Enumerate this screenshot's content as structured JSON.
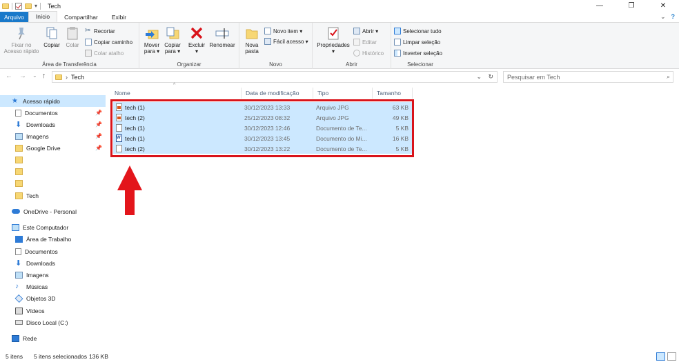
{
  "window": {
    "title": "Tech",
    "minimize": "—",
    "restore": "❐",
    "close": "✕"
  },
  "tabs": {
    "file": "Arquivo",
    "home": "Início",
    "share": "Compartilhar",
    "view": "Exibir"
  },
  "ribbon": {
    "clipboard": {
      "label": "Área de Transferência",
      "pin_quick": "Fixar no\nAcesso rápido",
      "copy": "Copiar",
      "paste": "Colar",
      "cut": "Recortar",
      "copy_path": "Copiar caminho",
      "paste_shortcut": "Colar atalho"
    },
    "organize": {
      "label": "Organizar",
      "move_to": "Mover\npara ▾",
      "copy_to": "Copiar\npara ▾",
      "delete": "Excluir\n▾",
      "rename": "Renomear"
    },
    "new": {
      "label": "Novo",
      "new_folder": "Nova\npasta",
      "new_item": "Novo item ▾",
      "easy_access": "Fácil acesso ▾"
    },
    "open": {
      "label": "Abrir",
      "properties": "Propriedades\n▾",
      "open": "Abrir ▾",
      "edit": "Editar",
      "history": "Histórico"
    },
    "select": {
      "label": "Selecionar",
      "select_all": "Selecionar tudo",
      "select_none": "Limpar seleção",
      "invert": "Inverter seleção"
    }
  },
  "address": {
    "path": "Tech",
    "search_placeholder": "Pesquisar em Tech"
  },
  "nav": {
    "quick_access": "Acesso rápido",
    "quick_items": [
      "Documentos",
      "Downloads",
      "Imagens",
      "Google Drive",
      "",
      "",
      "",
      "Tech"
    ],
    "onedrive": "OneDrive - Personal",
    "this_pc": "Este Computador",
    "pc_items": [
      "Área de Trabalho",
      "Documentos",
      "Downloads",
      "Imagens",
      "Músicas",
      "Objetos 3D",
      "Vídeos",
      "Disco Local (C:)"
    ],
    "network": "Rede"
  },
  "columns": {
    "name": "Nome",
    "date": "Data de modificação",
    "type": "Tipo",
    "size": "Tamanho"
  },
  "files": [
    {
      "name": "tech (1)",
      "date": "30/12/2023 13:33",
      "type": "Arquivo JPG",
      "size": "63 KB",
      "icon": "jpg"
    },
    {
      "name": "tech (2)",
      "date": "25/12/2023 08:32",
      "type": "Arquivo JPG",
      "size": "49 KB",
      "icon": "jpg"
    },
    {
      "name": "tech (1)",
      "date": "30/12/2023 12:46",
      "type": "Documento de Te...",
      "size": "5 KB",
      "icon": "txt"
    },
    {
      "name": "tech (1)",
      "date": "30/12/2023 13:45",
      "type": "Documento do Mi...",
      "size": "16 KB",
      "icon": "doc"
    },
    {
      "name": "tech (2)",
      "date": "30/12/2023 13:22",
      "type": "Documento de Te...",
      "size": "5 KB",
      "icon": "txt"
    }
  ],
  "status": {
    "items": "5 itens",
    "selected": "5 itens selecionados",
    "size": "136 KB"
  },
  "colors": {
    "accent": "#1979ca",
    "selection": "#cce8ff",
    "highlight_red": "#d9131a"
  }
}
